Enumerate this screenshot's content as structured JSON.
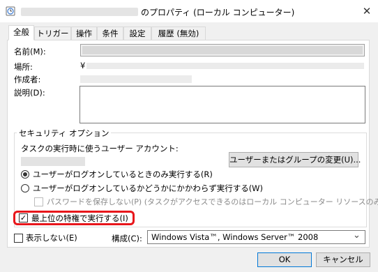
{
  "window": {
    "title_suffix": "のプロパティ (ローカル コンピューター)",
    "close_glyph": "✕"
  },
  "tabs": [
    {
      "label": "全般",
      "active": true
    },
    {
      "label": "トリガー"
    },
    {
      "label": "操作"
    },
    {
      "label": "条件"
    },
    {
      "label": "設定"
    },
    {
      "label": "履歴 (無効)"
    }
  ],
  "general": {
    "name_label": "名前(M):",
    "location_label": "場所:",
    "location_value": "¥",
    "author_label": "作成者:",
    "description_label": "説明(D):"
  },
  "security": {
    "group_label": "セキュリティ オプション",
    "account_prompt": "タスクの実行時に使うユーザー アカウント:",
    "change_user_button": "ユーザーまたはグループの変更(U)...",
    "radio_logged_on": "ユーザーがログオンしているときのみ実行する(R)",
    "radio_any": "ユーザーがログオンしているかどうかにかかわらず実行する(W)",
    "no_store_password": "パスワードを保存しない(P) (タスクがアクセスできるのはローカル コンピューター リソースのみ)",
    "highest_privileges": "最上位の特権で実行する(I)",
    "highest_privileges_check": "✓"
  },
  "footer": {
    "hidden_label": "表示しない(E)",
    "configure_label": "構成(C):",
    "configure_value": "Windows Vista™, Windows Server™ 2008",
    "dropdown_glyph": "⌄",
    "ok_button": "OK",
    "cancel_button": "キャンセル"
  },
  "colors": {
    "highlight": "#e8161b",
    "default_button_border": "#0078d7"
  }
}
